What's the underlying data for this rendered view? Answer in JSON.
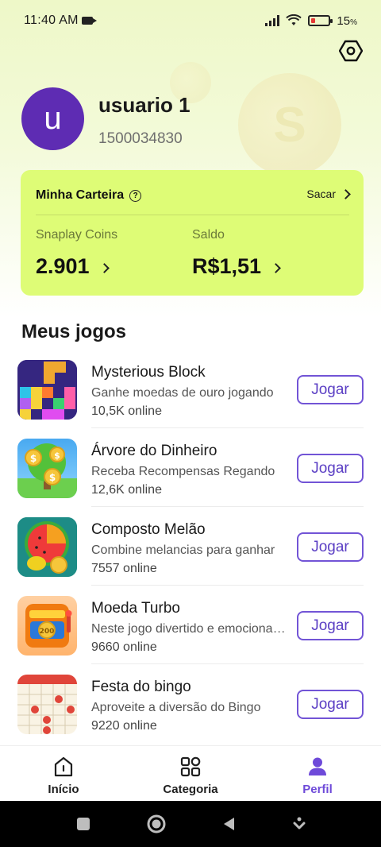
{
  "status_bar": {
    "time": "11:40 AM",
    "battery": "15"
  },
  "profile": {
    "avatar_letter": "u",
    "username": "usuario 1",
    "user_id": "1500034830"
  },
  "wallet": {
    "title": "Minha Carteira",
    "withdraw_label": "Sacar",
    "coins_label": "Snaplay Coins",
    "coins_value": "2.901",
    "balance_label": "Saldo",
    "balance_value": "R$1,51"
  },
  "games_section": {
    "title": "Meus jogos"
  },
  "games": [
    {
      "name": "Mysterious Block",
      "description": "Ganhe moedas de ouro jogando",
      "online": "10,5K online",
      "button": "Jogar",
      "icon": "block-puzzle-icon"
    },
    {
      "name": "Árvore do Dinheiro",
      "description": "Receba Recompensas Regando",
      "online": "12,6K online",
      "button": "Jogar",
      "icon": "money-tree-icon"
    },
    {
      "name": "Composto Melão",
      "description": "Combine melancias para ganhar",
      "online": "7557 online",
      "button": "Jogar",
      "icon": "watermelon-icon"
    },
    {
      "name": "Moeda Turbo",
      "description": "Neste jogo divertido e emocionante",
      "online": "9660 online",
      "button": "Jogar",
      "icon": "slot-machine-icon"
    },
    {
      "name": "Festa do bingo",
      "description": "Aproveite a diversão do Bingo",
      "online": "9220 online",
      "button": "Jogar",
      "icon": "bingo-card-icon"
    }
  ],
  "bottom_nav": [
    {
      "label": "Início",
      "icon": "home-icon",
      "active": false
    },
    {
      "label": "Categoria",
      "icon": "grid-icon",
      "active": false
    },
    {
      "label": "Perfil",
      "icon": "person-icon",
      "active": true
    }
  ],
  "colors": {
    "accent": "#6e4ad9",
    "wallet_bg": "#defc76",
    "avatar_bg": "#5e2cb3"
  }
}
